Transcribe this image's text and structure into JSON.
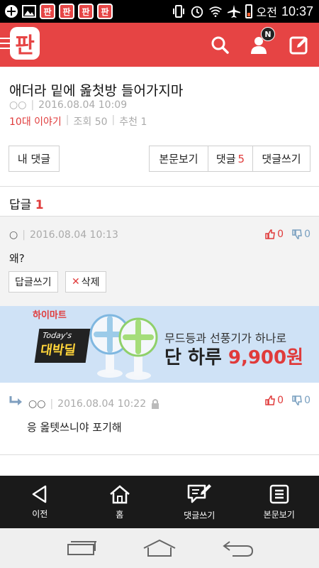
{
  "status_bar": {
    "ampm": "오전",
    "time": "10:37",
    "app_icon_label": "판",
    "colors": {
      "background": "#000000",
      "battery": "#f25c2a"
    }
  },
  "header": {
    "logo": "판",
    "badge": "N",
    "icons": [
      "menu-icon",
      "search-icon",
      "user-icon",
      "write-icon"
    ],
    "colors": {
      "background": "#e64444"
    }
  },
  "post": {
    "title": "애더라 밑에 옲첫방 들어가지마",
    "author": "○○",
    "date": "2016.08.04 10:09",
    "category": "10대 이야기",
    "views": "조회 50",
    "recommends": "추천 1"
  },
  "actions": {
    "my_comments": "내 댓글",
    "view_post": "본문보기",
    "comments_label": "댓글",
    "comments_count": "5",
    "write_comment": "댓글쓰기"
  },
  "replies": {
    "label": "답글",
    "count": "1"
  },
  "comment_main": {
    "author": "○",
    "date": "2016.08.04 10:13",
    "up": "0",
    "down": "0",
    "text": "왜?",
    "reply_button": "답글쓰기",
    "delete_button": "삭제"
  },
  "ad": {
    "brand": "하이마트",
    "badge_top": "Today's",
    "badge_main": "대박딜",
    "line1": "무드등과 선풍기가 하나로",
    "line2_prefix": "단 하루",
    "price": "9,900원"
  },
  "comment_reply": {
    "author": "○○",
    "date": "2016.08.04 10:22",
    "up": "0",
    "down": "0",
    "text": "응 옲텟쓰니야 포기해"
  },
  "bottom_nav": [
    {
      "label": "이전",
      "icon": "back-triangle-icon"
    },
    {
      "label": "홈",
      "icon": "home-icon"
    },
    {
      "label": "댓글쓰기",
      "icon": "comment-write-icon"
    },
    {
      "label": "본문보기",
      "icon": "document-icon"
    }
  ],
  "system_nav": [
    "recent-apps-icon",
    "home-icon",
    "back-icon"
  ]
}
